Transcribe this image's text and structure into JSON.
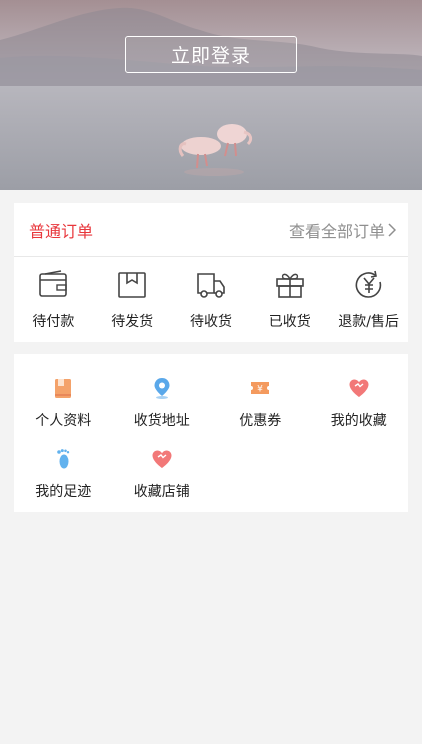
{
  "hero": {
    "login_label": "立即登录"
  },
  "orders": {
    "title": "普通订单",
    "view_all": "查看全部订单",
    "title_color": "#e8373c",
    "items": [
      {
        "label": "待付款",
        "icon": "wallet-icon"
      },
      {
        "label": "待发货",
        "icon": "package-box-icon"
      },
      {
        "label": "待收货",
        "icon": "delivery-truck-icon"
      },
      {
        "label": "已收货",
        "icon": "gift-box-icon"
      },
      {
        "label": "退款/售后",
        "icon": "yen-refund-icon"
      }
    ]
  },
  "services": {
    "items": [
      {
        "label": "个人资料",
        "icon": "profile-book-icon",
        "color": "#f4a26a"
      },
      {
        "label": "收货地址",
        "icon": "location-pin-icon",
        "color": "#5aa8ea"
      },
      {
        "label": "优惠券",
        "icon": "coupon-ticket-icon",
        "color": "#f49a5e"
      },
      {
        "label": "我的收藏",
        "icon": "heart-icon",
        "color": "#f27878"
      },
      {
        "label": "我的足迹",
        "icon": "footprint-icon",
        "color": "#62b2ee"
      },
      {
        "label": "收藏店铺",
        "icon": "heart-shop-icon",
        "color": "#f27878"
      }
    ]
  }
}
